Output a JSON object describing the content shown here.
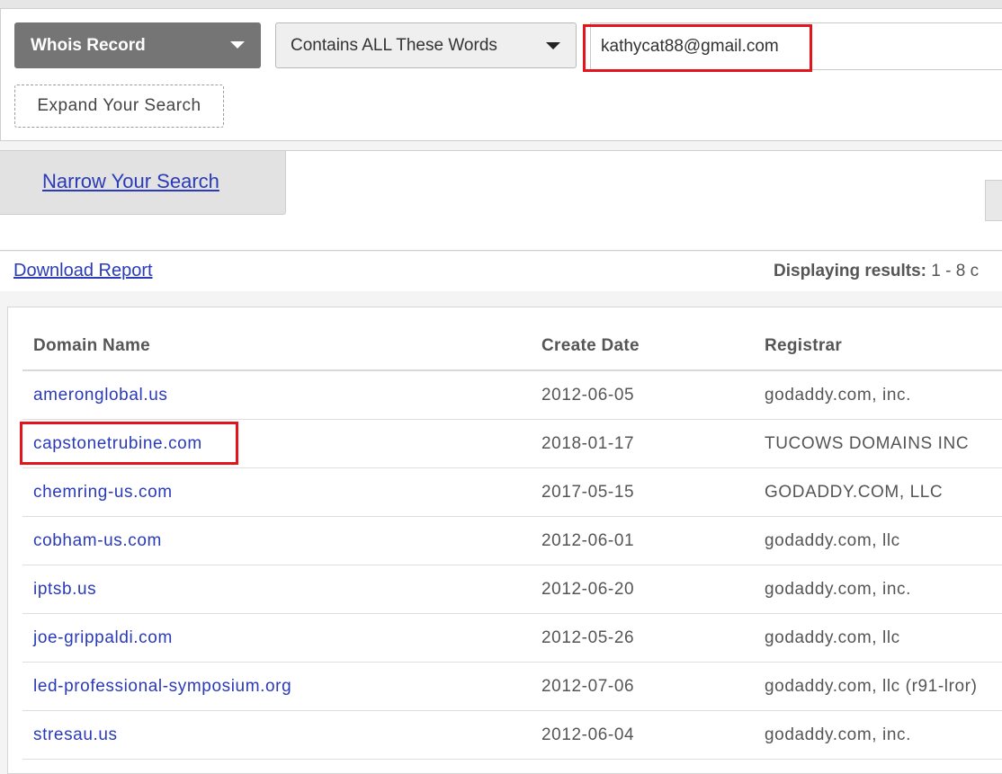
{
  "search": {
    "record_type": "Whois Record",
    "match_mode": "Contains ALL These Words",
    "query": "kathycat88@gmail.com",
    "expand_label": "Expand Your Search"
  },
  "narrow": {
    "label": "Narrow Your Search"
  },
  "report": {
    "download_label": "Download Report",
    "results_label": "Displaying results:",
    "results_range": "1 - 8 c"
  },
  "table": {
    "headers": [
      "Domain Name",
      "Create Date",
      "Registrar"
    ],
    "rows": [
      {
        "domain": "ameronglobal.us",
        "date": "2012-06-05",
        "registrar": "godaddy.com, inc."
      },
      {
        "domain": "capstonetrubine.com",
        "date": "2018-01-17",
        "registrar": "TUCOWS DOMAINS INC"
      },
      {
        "domain": "chemring-us.com",
        "date": "2017-05-15",
        "registrar": "GODADDY.COM, LLC"
      },
      {
        "domain": "cobham-us.com",
        "date": "2012-06-01",
        "registrar": "godaddy.com, llc"
      },
      {
        "domain": "iptsb.us",
        "date": "2012-06-20",
        "registrar": "godaddy.com, inc."
      },
      {
        "domain": "joe-grippaldi.com",
        "date": "2012-05-26",
        "registrar": "godaddy.com, llc"
      },
      {
        "domain": "led-professional-symposium.org",
        "date": "2012-07-06",
        "registrar": "godaddy.com, llc (r91-lror)"
      },
      {
        "domain": "stresau.us",
        "date": "2012-06-04",
        "registrar": "godaddy.com, inc."
      }
    ]
  },
  "colors": {
    "link": "#2a3ab8",
    "highlight": "#e3141b",
    "select_dark": "#757575"
  },
  "icons": {
    "record_caret": "caret-down-icon",
    "match_caret": "caret-down-icon"
  }
}
